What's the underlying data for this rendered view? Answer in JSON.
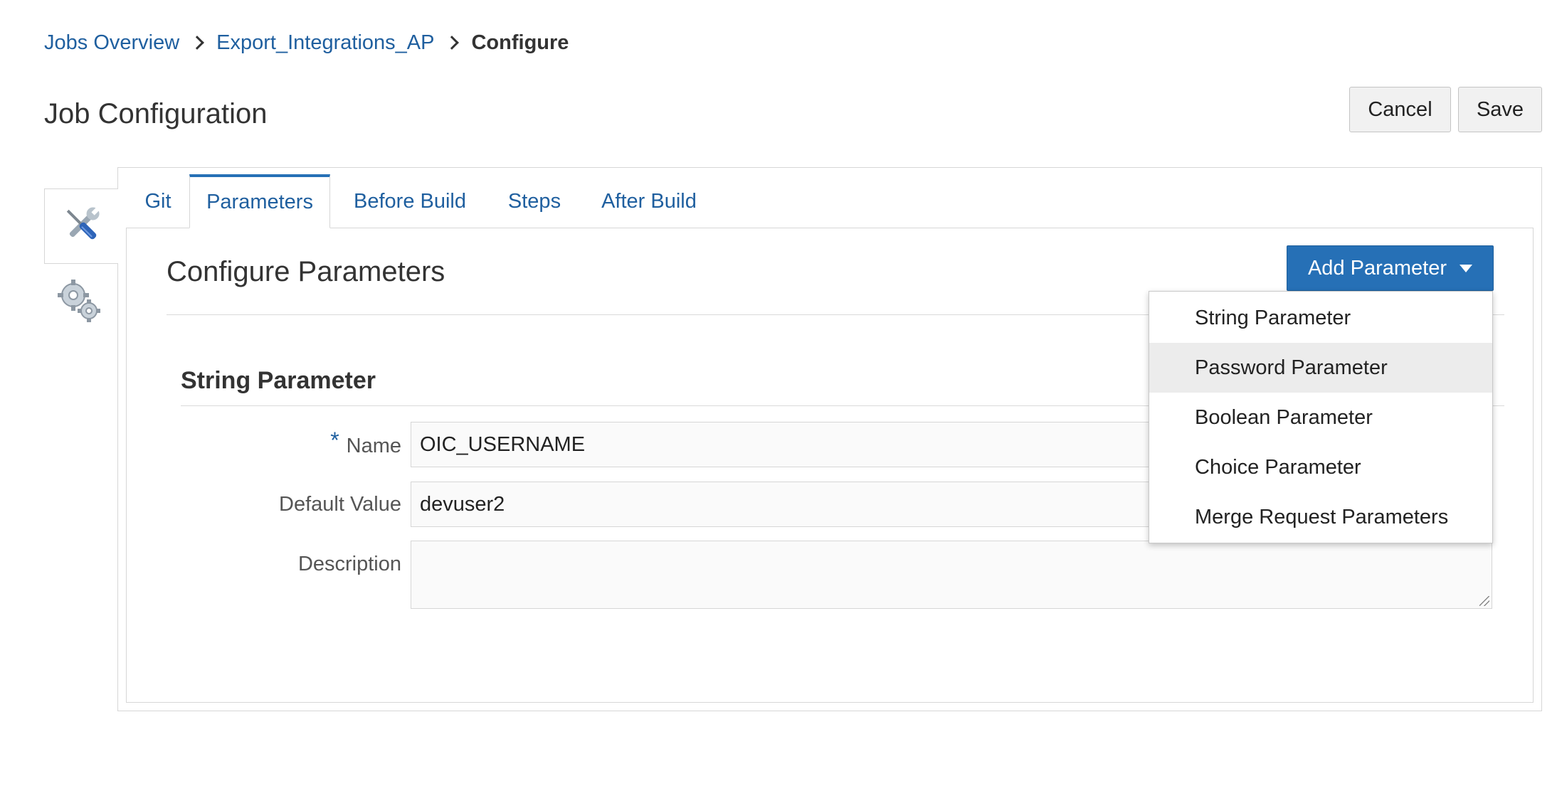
{
  "breadcrumb": {
    "items": [
      "Jobs Overview",
      "Export_Integrations_AP"
    ],
    "current": "Configure"
  },
  "page": {
    "title": "Job Configuration"
  },
  "actions": {
    "cancel_label": "Cancel",
    "save_label": "Save"
  },
  "side_rail": [
    {
      "icon": "tools-icon",
      "active": true
    },
    {
      "icon": "gears-icon",
      "active": false
    }
  ],
  "tabs": [
    {
      "label": "Git",
      "active": false
    },
    {
      "label": "Parameters",
      "active": true
    },
    {
      "label": "Before Build",
      "active": false
    },
    {
      "label": "Steps",
      "active": false
    },
    {
      "label": "After Build",
      "active": false
    }
  ],
  "section": {
    "title": "Configure Parameters",
    "add_button_label": "Add Parameter"
  },
  "parameter": {
    "type_title": "String Parameter",
    "required_marker": "*",
    "name_label": "Name",
    "name_value": "OIC_USERNAME",
    "default_label": "Default Value",
    "default_value": "devuser2",
    "description_label": "Description",
    "description_value": ""
  },
  "dropdown": {
    "items": [
      {
        "label": "String Parameter",
        "highlighted": false
      },
      {
        "label": "Password Parameter",
        "highlighted": true
      },
      {
        "label": "Boolean Parameter",
        "highlighted": false
      },
      {
        "label": "Choice Parameter",
        "highlighted": false
      },
      {
        "label": "Merge Request Parameters",
        "highlighted": false
      }
    ]
  },
  "colors": {
    "link": "#1f5f9f",
    "primary_button": "#2670b6",
    "active_tab_border": "#2670b6",
    "menu_hover": "#ececec"
  }
}
